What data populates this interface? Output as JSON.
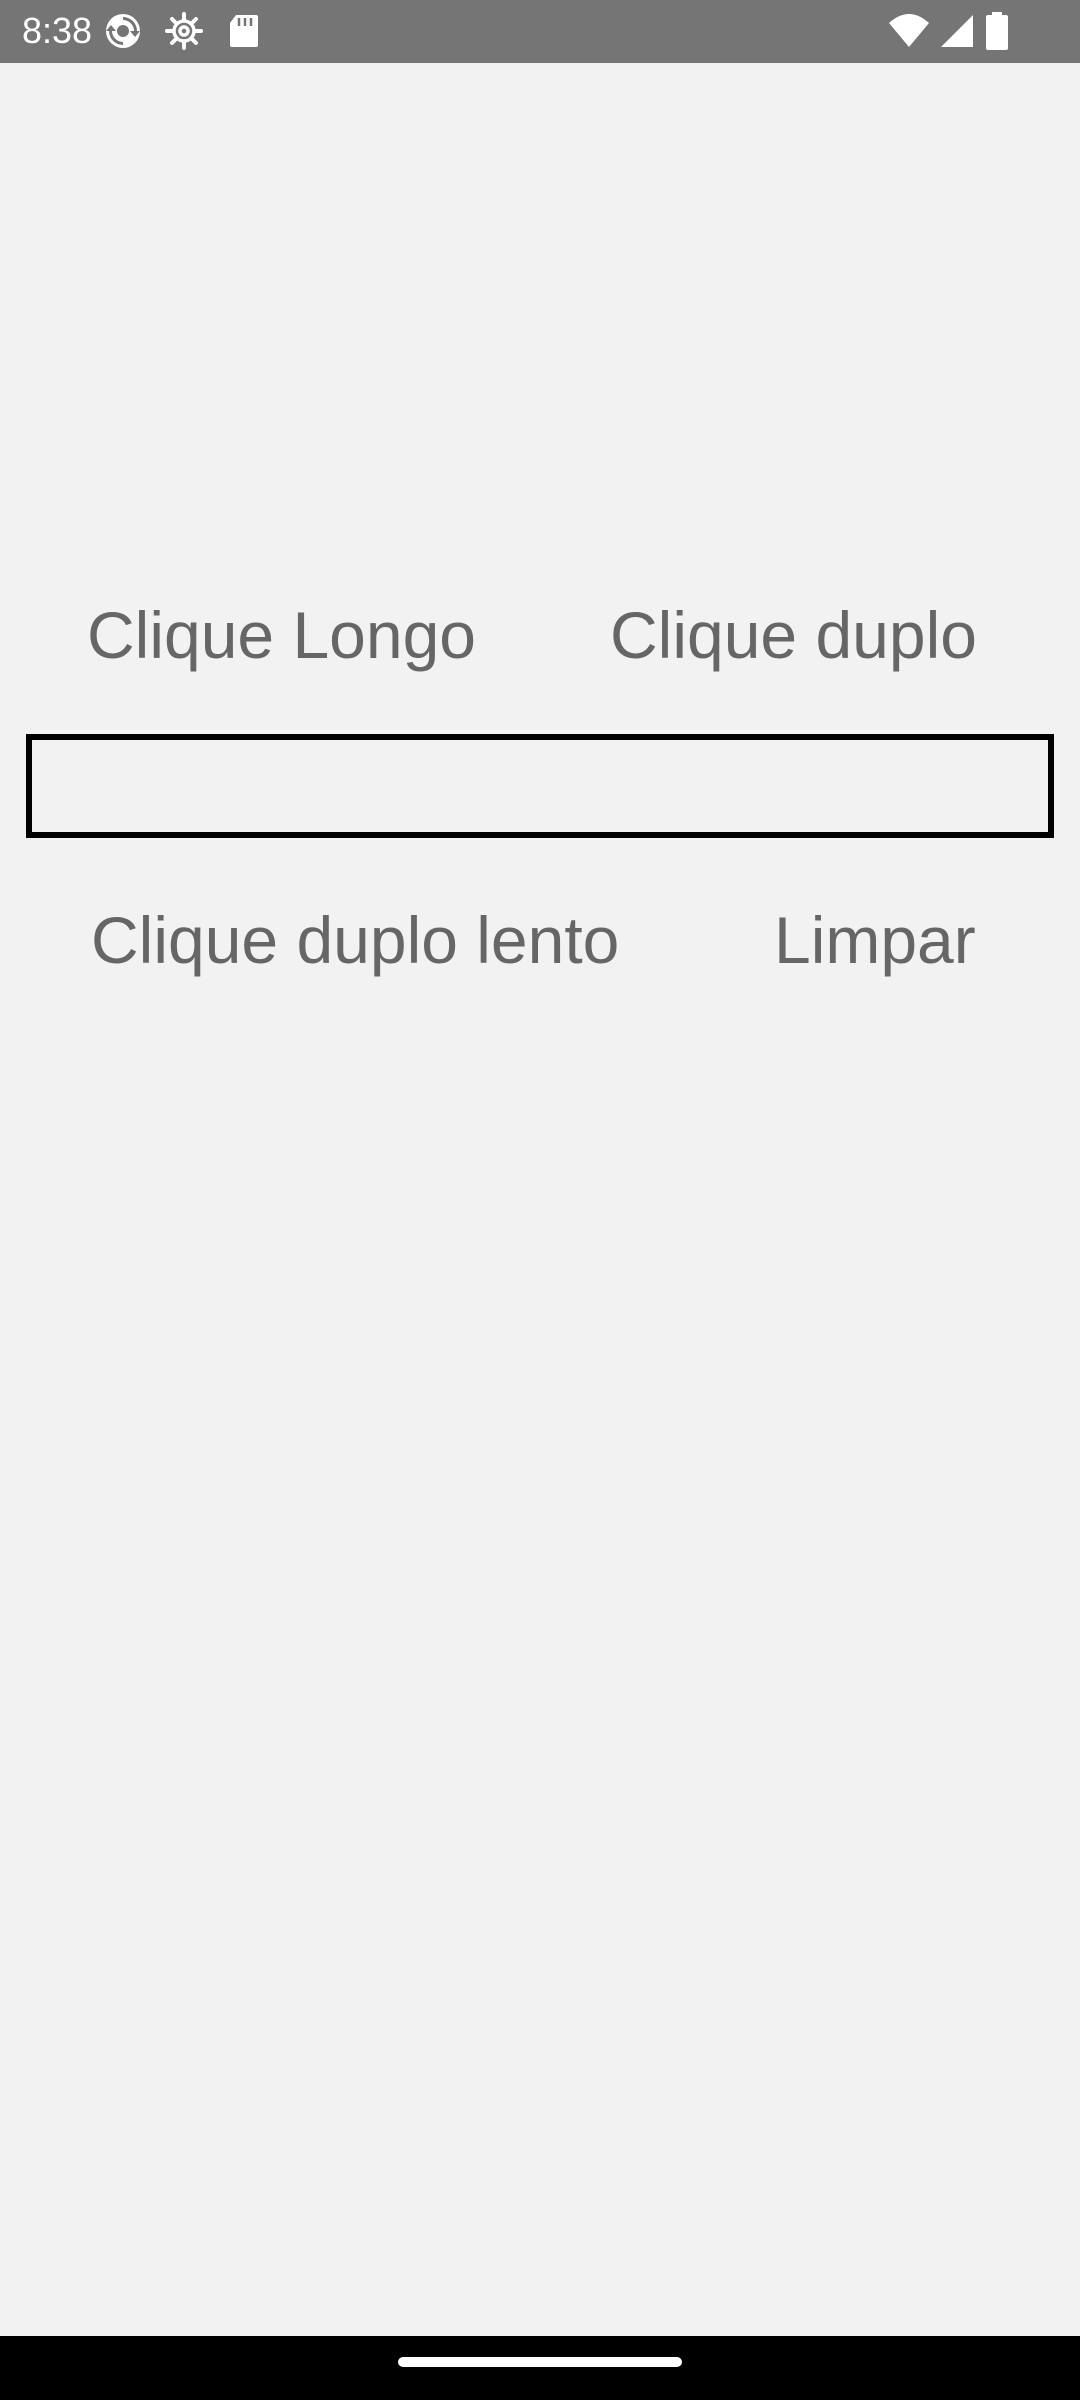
{
  "status_bar": {
    "time": "8:38",
    "background_color": "#757575",
    "icons": [
      "sync-icon",
      "settings-icon",
      "sd-card-icon",
      "wifi-icon",
      "cell-signal-icon",
      "battery-icon"
    ]
  },
  "buttons": {
    "long_click_label": "Clique Longo",
    "double_click_label": "Clique duplo",
    "slow_double_click_label": "Clique duplo lento",
    "clear_label": "Limpar"
  },
  "text_field": {
    "value": "",
    "placeholder": ""
  },
  "colors": {
    "background": "#f2f2f2",
    "button_text": "#666666",
    "field_border": "#000000",
    "nav_bar": "#000000"
  }
}
